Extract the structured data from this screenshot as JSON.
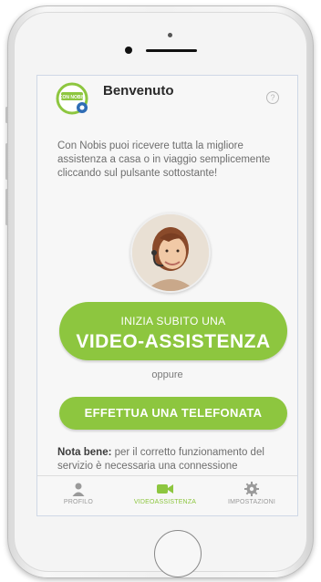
{
  "header": {
    "title": "Benvenuto",
    "help_icon": "question-circle-icon"
  },
  "logo": {
    "name": "nobis-logo-icon",
    "text": "CON NOBIS",
    "accent": "#8dc63f"
  },
  "intro_text": "Con Nobis puoi ricevere tutta la migliore assistenza a casa o in viaggio semplicemente cliccando sul pulsante sottostante!",
  "video_button": {
    "line1": "INIZIA SUBITO UNA",
    "line2": "VIDEO-ASSISTENZA"
  },
  "separator": "oppure",
  "phone_button": {
    "label": "EFFETTUA UNA TELEFONATA"
  },
  "note": {
    "bold": "Nota bene:",
    "text": " per il corretto funzionamento del servizio è necessaria una connessione"
  },
  "tabs": [
    {
      "label": "PROFILO",
      "icon": "user-icon"
    },
    {
      "label": "VIDEOASSISTENZA",
      "icon": "video-camera-icon"
    },
    {
      "label": "IMPOSTAZIONI",
      "icon": "gear-icon"
    }
  ],
  "colors": {
    "accent": "#8dc63f",
    "text": "#6e6e6e",
    "title": "#2a2a2a"
  }
}
